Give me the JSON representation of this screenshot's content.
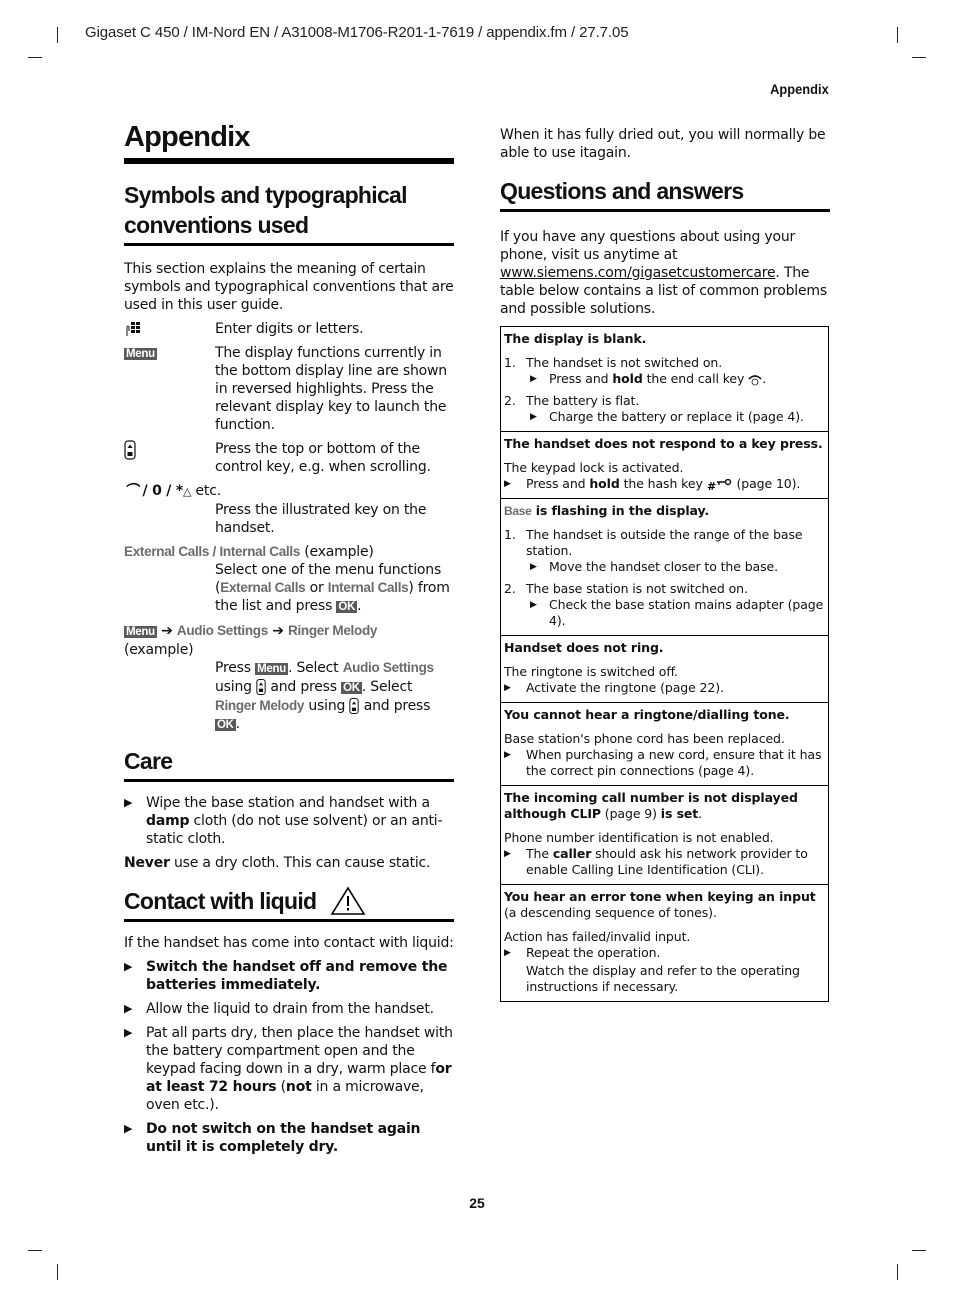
{
  "header": {
    "doc_line": "Gigaset C 450 / IM-Nord EN / A31008-M1706-R201-1-7619 / appendix.fm / 27.7.05",
    "running_head": "Appendix",
    "page_number": "25"
  },
  "left": {
    "title": "Appendix",
    "symbols": {
      "heading": "Symbols and typographical conventions used",
      "intro": "This section explains the meaning of certain symbols and typographical conventions that are used in this user guide.",
      "rows": [
        {
          "icon": "keypad-icon",
          "desc": "Enter digits or letters."
        },
        {
          "key_label": "Menu",
          "desc": "The display functions currently in the bottom display line are shown in reversed highlights. Press the relevant display key to launch the function."
        },
        {
          "icon": "control-key-icon",
          "desc": "Press the top or bottom of the control key, e.g. when scrolling."
        },
        {
          "key_text": " / 0 / *",
          "key_suffix": " etc.",
          "desc": "Press the illustrated key on the handset."
        }
      ],
      "example1": {
        "term_a": "External Calls",
        "sep": " / ",
        "term_b": "Internal Calls",
        "suffix": " (example)",
        "desc_1": "Select one of the menu functions (",
        "desc_or": " or ",
        "desc_2": ") from the list and press ",
        "ok": "OK",
        "end": "."
      },
      "example2": {
        "menu": "Menu",
        "arrow": "➔",
        "term_a": "Audio Settings",
        "term_b": "Ringer  Melody",
        "suffix": "(example)",
        "d1": "Press ",
        "d2": ". Select ",
        "d3": "using ",
        "d4": " and press ",
        "d5": ". Select ",
        "d6": " using ",
        "d7": " and press ",
        "ok": "OK",
        "end": "."
      }
    },
    "care": {
      "heading": "Care",
      "bullet_1a": "Wipe the base station and handset with a ",
      "bullet_1b": "damp",
      "bullet_1c": " cloth (do not use solvent) or an anti-static cloth.",
      "note_a": "Never",
      "note_b": " use a dry cloth. This can cause static."
    },
    "liquid": {
      "heading": "Contact with liquid",
      "intro": "If the handset has come into contact with liquid:",
      "b1": "Switch the handset off and remove the batteries immediately.",
      "b2": "Allow the liquid to drain from the handset.",
      "b3a": "Pat all parts dry, then place the handset with the battery compartment open and the keypad facing down in a dry, warm place f",
      "b3b": "or at least 72 hours",
      "b3c": " (",
      "b3d": "not",
      "b3e": " in a microwave, oven etc.).",
      "b4": "Do not switch on the handset again until it is completely dry."
    }
  },
  "right": {
    "dried_note": "When it has fully dried out, you will normally be able to use itagain.",
    "qa": {
      "heading": "Questions and answers",
      "intro_a": "If you have any questions about using your phone, visit us anytime at ",
      "link": "www.siemens.com/gigasetcustomercare",
      "intro_b": ". The table below contains a list of common problems and possible solutions.",
      "rows": [
        {
          "q": "The display is blank.",
          "n1": "1.",
          "c1": "The handset is not switched on.",
          "a1a": "Press and ",
          "a1b": "hold",
          "a1c": " the end call key ",
          "n2": "2.",
          "c2": "The battery is flat.",
          "a2": "Charge the battery or replace it (page 4)."
        },
        {
          "q": "The handset does not respond to a key press.",
          "cause": "The keypad lock is activated.",
          "a_a": "Press and ",
          "a_b": "hold",
          "a_c": " the hash key ",
          "a_d": " (page 10)."
        },
        {
          "q_label": "Base",
          "q": " is flashing in the display.",
          "n1": "1.",
          "c1": "The handset is outside the range of the base station.",
          "a1": "Move the handset closer to the base.",
          "n2": "2.",
          "c2": "The base station is not switched on.",
          "a2": "Check the base station mains adapter (page 4)."
        },
        {
          "q": "Handset does not ring.",
          "cause": "The ringtone is switched off.",
          "a": "Activate the ringtone (page 22)."
        },
        {
          "q": "You cannot hear a ringtone/dialling tone.",
          "cause": "Base station's phone cord has been replaced.",
          "a": "When purchasing a new cord, ensure that it has the correct pin connections (page 4)."
        },
        {
          "q_a": "The incoming call number is not displayed although CLIP",
          "q_b": " (page 9) ",
          "q_c": "is set",
          "q_d": ".",
          "cause": "Phone number identification is not enabled.",
          "a_a": "The ",
          "a_b": "caller",
          "a_c": " should ask his network provider to enable Calling Line Identification (CLI)."
        },
        {
          "q": "You hear an error tone when keying an input",
          "q_note": "(a descending sequence of tones).",
          "cause": "Action has failed/invalid input.",
          "a1": "Repeat the operation.",
          "a2": "Watch the display and refer to the operating instructions if necessary."
        }
      ]
    }
  }
}
